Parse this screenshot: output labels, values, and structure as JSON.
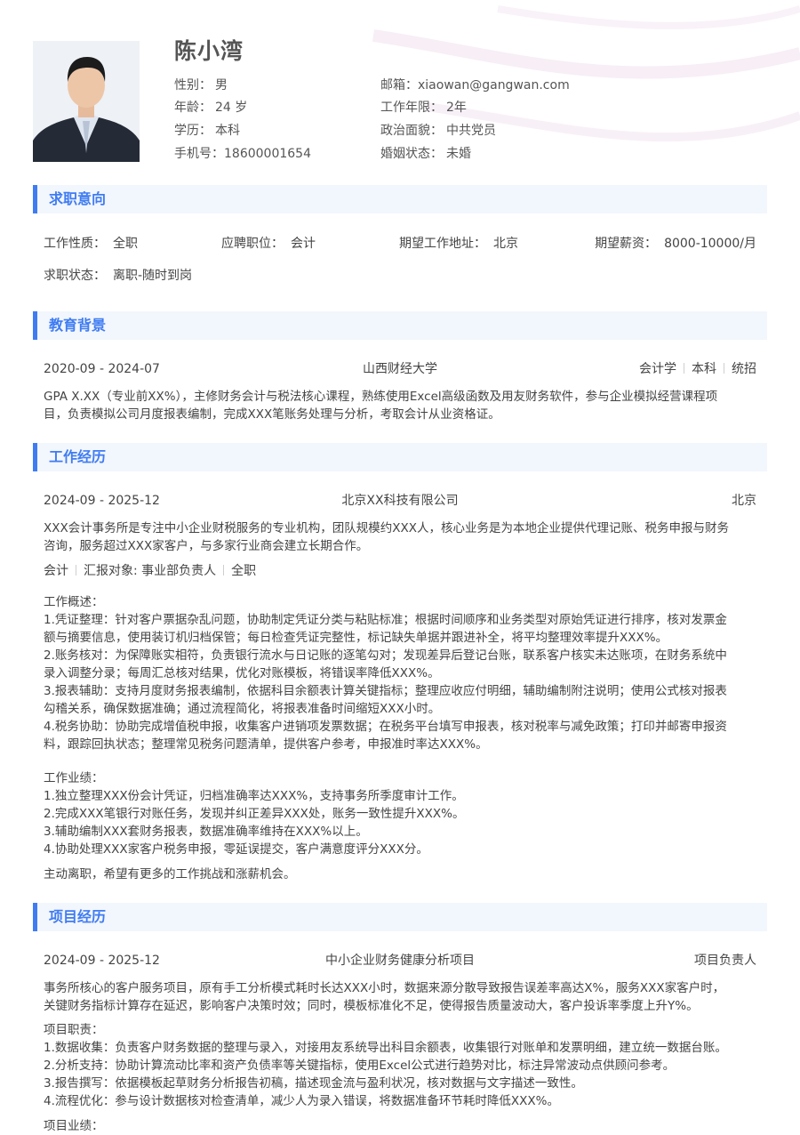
{
  "profile": {
    "name": "陈小湾",
    "photo_icon": "person-portrait-icon",
    "fields": [
      {
        "label": "性别：",
        "value": "男"
      },
      {
        "label": "邮箱：",
        "value": "xiaowan@gangwan.com"
      },
      {
        "label": "年龄：",
        "value": "24 岁"
      },
      {
        "label": "工作年限：",
        "value": "2年"
      },
      {
        "label": "学历：",
        "value": "本科"
      },
      {
        "label": "政治面貌：",
        "value": "中共党员"
      },
      {
        "label": "手机号：",
        "value": "18600001654"
      },
      {
        "label": "婚姻状态：",
        "value": "未婚"
      }
    ]
  },
  "intent": {
    "title": "求职意向",
    "items": [
      {
        "label": "工作性质：",
        "value": "全职"
      },
      {
        "label": "应聘职位：",
        "value": "会计"
      },
      {
        "label": "期望工作地址：",
        "value": "北京"
      },
      {
        "label": "期望薪资：",
        "value": "8000-10000/月"
      },
      {
        "label": "求职状态：",
        "value": "离职-随时到岗"
      }
    ]
  },
  "education": {
    "title": "教育背景",
    "period": "2020-09 - 2024-07",
    "school": "山西财经大学",
    "tags": [
      "会计学",
      "本科",
      "统招"
    ],
    "desc": [
      "GPA X.XX（专业前XX%），主修财务会计与税法核心课程，熟练使用Excel高级函数及用友财务软件，参与企业模拟经营课程项",
      "目，负责模拟公司月度报表编制，完成XXX笔账务处理与分析，考取会计从业资格证。"
    ]
  },
  "work": {
    "title": "工作经历",
    "period": "2024-09 - 2025-12",
    "company": "北京XX科技有限公司",
    "city": "北京",
    "intro": [
      "XXX会计事务所是专注中小企业财税服务的专业机构，团队规模约XXX人，核心业务是为本地企业提供代理记账、税务申报与财务",
      "咨询，服务超过XXX家客户，与多家行业商会建立长期合作。"
    ],
    "tags": [
      "会计",
      "汇报对象: 事业部负责人",
      "全职"
    ],
    "overview_label": "工作概述：",
    "overview": [
      "1.凭证整理：针对客户票据杂乱问题，协助制定凭证分类与粘贴标准；根据时间顺序和业务类型对原始凭证进行排序，核对发票金",
      "额与摘要信息，使用装订机归档保管；每日检查凭证完整性，标记缺失单据并跟进补全，将平均整理效率提升XXX%。",
      "2.账务核对：为保障账实相符，负责银行流水与日记账的逐笔勾对；发现差异后登记台账，联系客户核实未达账项，在财务系统中",
      "录入调整分录；每周汇总核对结果，优化对账模板，将错误率降低XXX%。",
      "3.报表辅助：支持月度财务报表编制，依据科目余额表计算关键指标；整理应收应付明细，辅助编制附注说明；使用公式核对报表",
      "勾稽关系，确保数据准确；通过流程简化，将报表准备时间缩短XXX小时。",
      "4.税务协助：协助完成增值税申报，收集客户进销项发票数据；在税务平台填写申报表，核对税率与减免政策；打印并邮寄申报资",
      "料，跟踪回执状态；整理常见税务问题清单，提供客户参考，申报准时率达XXX%。"
    ],
    "achievements_label": "工作业绩：",
    "achievements": [
      "1.独立整理XXX份会计凭证，归档准确率达XXX%，支持事务所季度审计工作。",
      "2.完成XXX笔银行对账任务，发现并纠正差异XXX处，账务一致性提升XXX%。",
      "3.辅助编制XXX套财务报表，数据准确率维持在XXX%以上。",
      "4.协助处理XXX家客户税务申报，零延误提交，客户满意度评分XXX分。"
    ],
    "leave_reason": "主动离职，希望有更多的工作挑战和涨薪机会。"
  },
  "project": {
    "title": "项目经历",
    "period": "2024-09 - 2025-12",
    "name": "中小企业财务健康分析项目",
    "role": "项目负责人",
    "intro": [
      "事务所核心的客户服务项目，原有手工分析模式耗时长达XXX小时，数据来源分散导致报告误差率高达X%，服务XXX家客户时，",
      "关键财务指标计算存在延迟，影响客户决策时效；同时，模板标准化不足，使得报告质量波动大，客户投诉率季度上升Y%。"
    ],
    "duties_label": "项目职责：",
    "duties": [
      "1.数据收集：负责客户财务数据的整理与录入，对接用友系统导出科目余额表，收集银行对账单和发票明细，建立统一数据台账。",
      "2.分析支持：协助计算流动比率和资产负债率等关键指标，使用Excel公式进行趋势对比，标注异常波动点供顾问参考。",
      "3.报告撰写：依据模板起草财务分析报告初稿，描述现金流与盈利状况，核对数据与文字描述一致性。",
      "4.流程优化：参与设计数据核对检查清单，减少人为录入错误，将数据准备环节耗时降低XXX%。"
    ],
    "results_label": "项目业绩："
  }
}
